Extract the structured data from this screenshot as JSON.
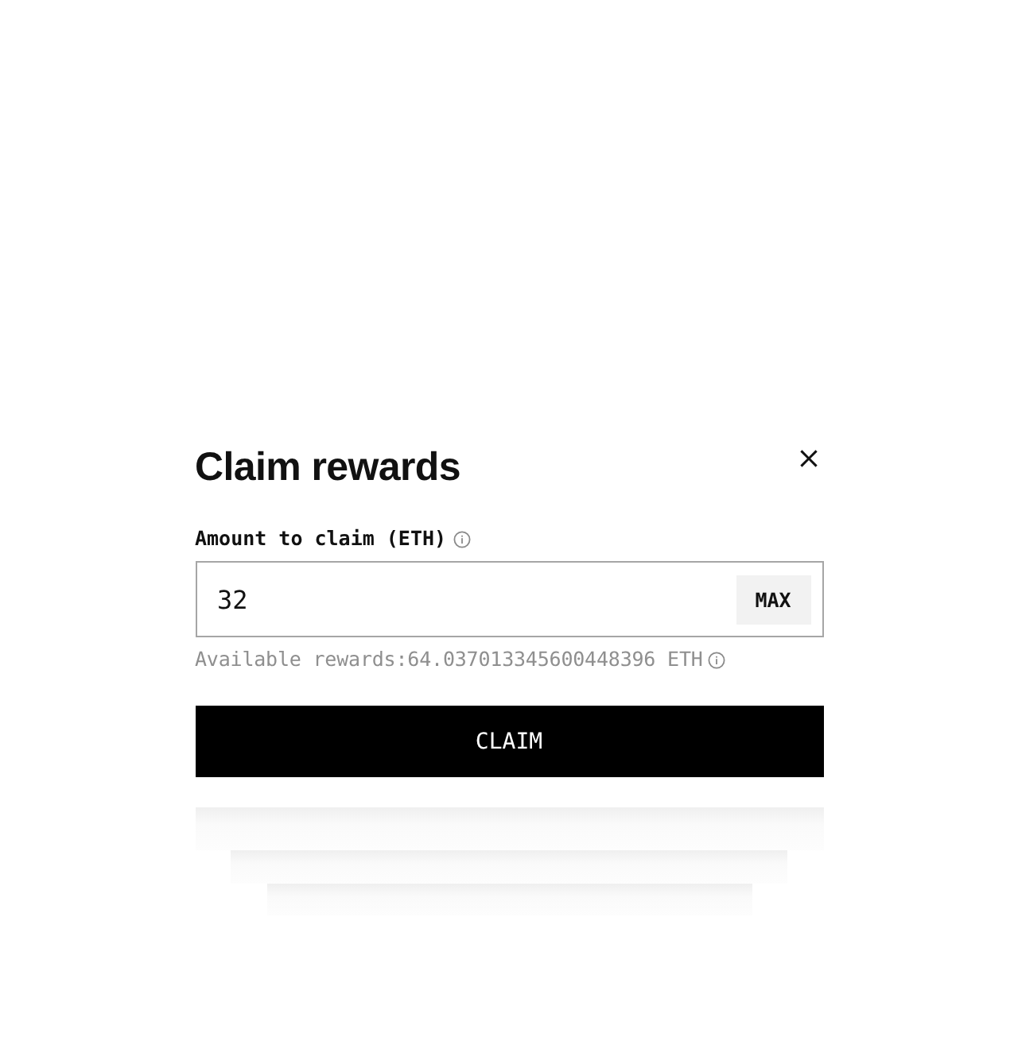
{
  "dialog": {
    "title": "Claim rewards",
    "amount_field": {
      "label": "Amount to claim (ETH)",
      "value": "32",
      "max_button": "MAX"
    },
    "available_rewards": "Available rewards:64.037013345600448396 ETH",
    "claim_button": "CLAIM"
  }
}
